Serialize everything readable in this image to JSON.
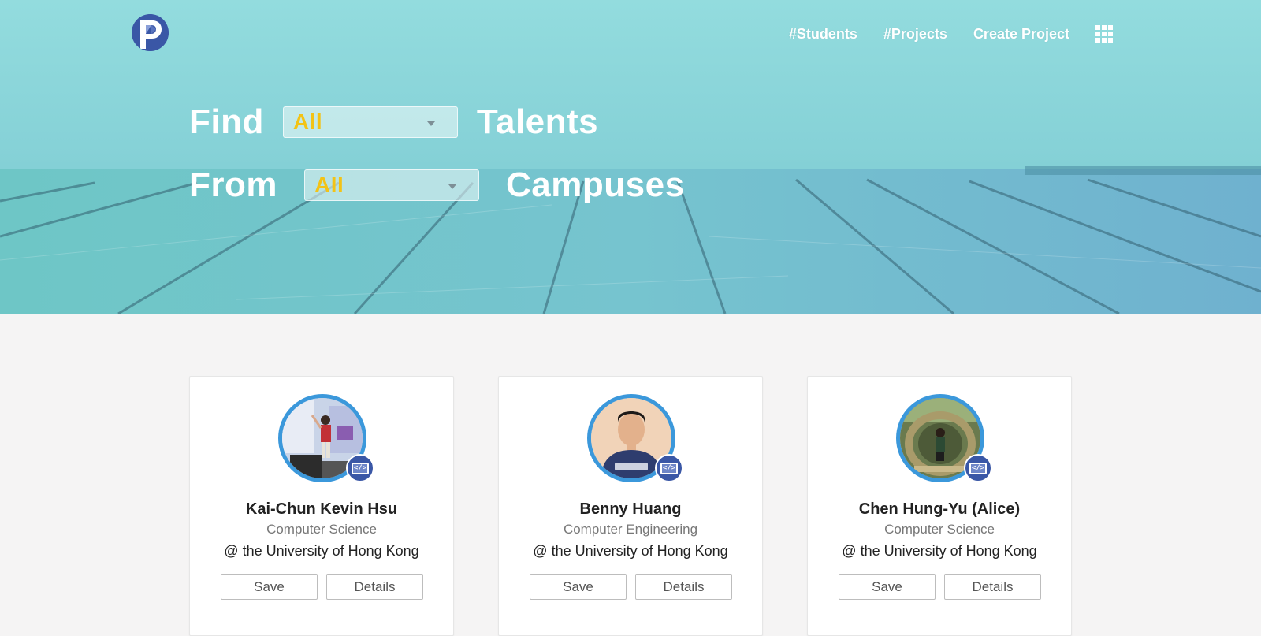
{
  "nav": {
    "students": "#Students",
    "projects": "#Projects",
    "create_project": "Create Project",
    "apps_icon": "grid-menu-icon"
  },
  "hero": {
    "find": "Find",
    "talent_filter": "All",
    "talents": "Talents",
    "from": "From",
    "campus_filter": "All",
    "campuses": "Campuses"
  },
  "colors": {
    "accent_yellow": "#f3c316",
    "avatar_ring": "#3b98db",
    "brand_blue": "#3a57a6"
  },
  "students": [
    {
      "name": "Kai-Chun Kevin Hsu",
      "major": "Computer Science",
      "school": "@ the University of Hong Kong",
      "save": "Save",
      "details": "Details"
    },
    {
      "name": "Benny Huang",
      "major": "Computer Engineering",
      "school": "@ the University of Hong Kong",
      "save": "Save",
      "details": "Details"
    },
    {
      "name": "Chen Hung-Yu (Alice)",
      "major": "Computer Science",
      "school": "@ the University of Hong Kong",
      "save": "Save",
      "details": "Details"
    }
  ]
}
